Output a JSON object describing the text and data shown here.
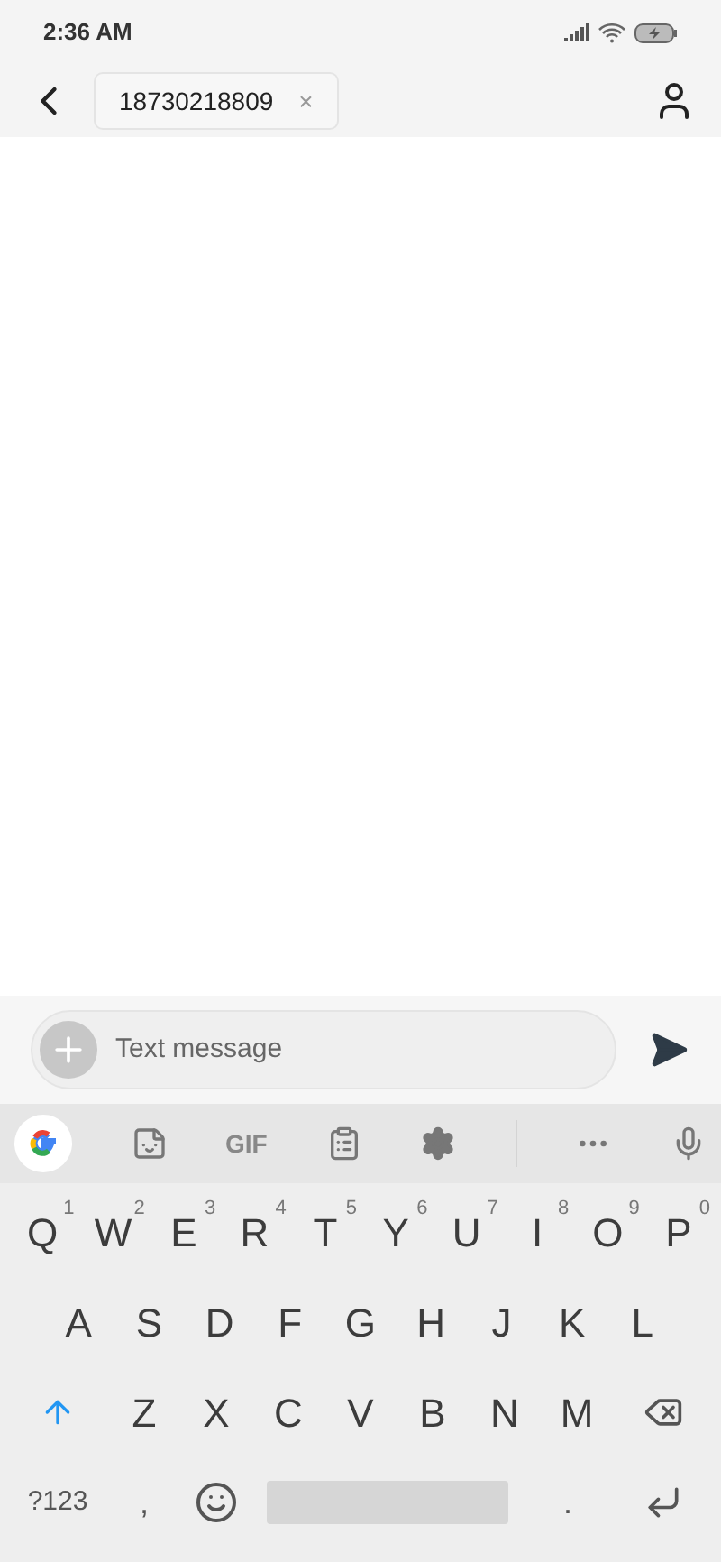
{
  "status_bar": {
    "time": "2:36 AM"
  },
  "header": {
    "recipient": "18730218809",
    "remove": "×"
  },
  "compose": {
    "placeholder": "Text message"
  },
  "keyboard_toolbar": {
    "gif": "GIF"
  },
  "keyboard": {
    "rows": [
      [
        {
          "label": "Q",
          "hint": "1"
        },
        {
          "label": "W",
          "hint": "2"
        },
        {
          "label": "E",
          "hint": "3"
        },
        {
          "label": "R",
          "hint": "4"
        },
        {
          "label": "T",
          "hint": "5"
        },
        {
          "label": "Y",
          "hint": "6"
        },
        {
          "label": "U",
          "hint": "7"
        },
        {
          "label": "I",
          "hint": "8"
        },
        {
          "label": "O",
          "hint": "9"
        },
        {
          "label": "P",
          "hint": "0"
        }
      ],
      [
        {
          "label": "A"
        },
        {
          "label": "S"
        },
        {
          "label": "D"
        },
        {
          "label": "F"
        },
        {
          "label": "G"
        },
        {
          "label": "H"
        },
        {
          "label": "J"
        },
        {
          "label": "K"
        },
        {
          "label": "L"
        }
      ],
      [
        {
          "label": "Z"
        },
        {
          "label": "X"
        },
        {
          "label": "C"
        },
        {
          "label": "V"
        },
        {
          "label": "B"
        },
        {
          "label": "N"
        },
        {
          "label": "M"
        }
      ]
    ],
    "symbols_key": "?123",
    "comma_key": ",",
    "period_key": "."
  }
}
